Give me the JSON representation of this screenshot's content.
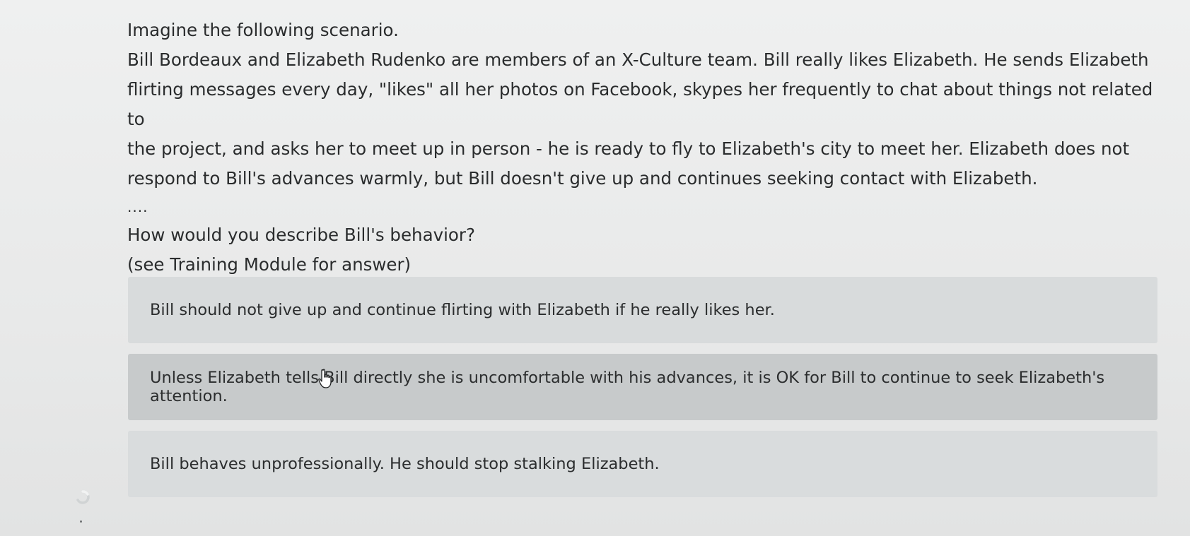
{
  "question": {
    "intro": "Imagine the following scenario.",
    "scenario_lines": [
      "Bill Bordeaux and Elizabeth Rudenko are members of an X-Culture team. Bill really likes Elizabeth. He sends Elizabeth",
      "flirting messages every day, \"likes\" all her photos on Facebook, skypes her frequently to chat about things not related to",
      "the project, and asks her to meet up in person - he is ready to fly to Elizabeth's city to meet her. Elizabeth does not",
      "respond to Bill's advances warmly, but Bill doesn't give up and continues seeking contact with Elizabeth."
    ],
    "separator": "....",
    "prompt": "How would you describe Bill's behavior?",
    "hint": "(see Training Module for answer)"
  },
  "options": [
    {
      "label": "Bill should not give up and continue flirting with Elizabeth if he really likes her."
    },
    {
      "label": "Unless Elizabeth tells Bill directly she is uncomfortable with his advances, it is OK for Bill to continue to seek Elizabeth's attention."
    },
    {
      "label": "Bill behaves unprofessionally. He should stop stalking Elizabeth."
    }
  ],
  "icons": {
    "cursor": "hand-pointer-icon",
    "loading": "loading-spinner-icon"
  },
  "colors": {
    "background": "#e9eaea",
    "option_background": "#d8dbdc",
    "option_hover_background": "#c7cacb",
    "text": "#2b2d2e"
  }
}
